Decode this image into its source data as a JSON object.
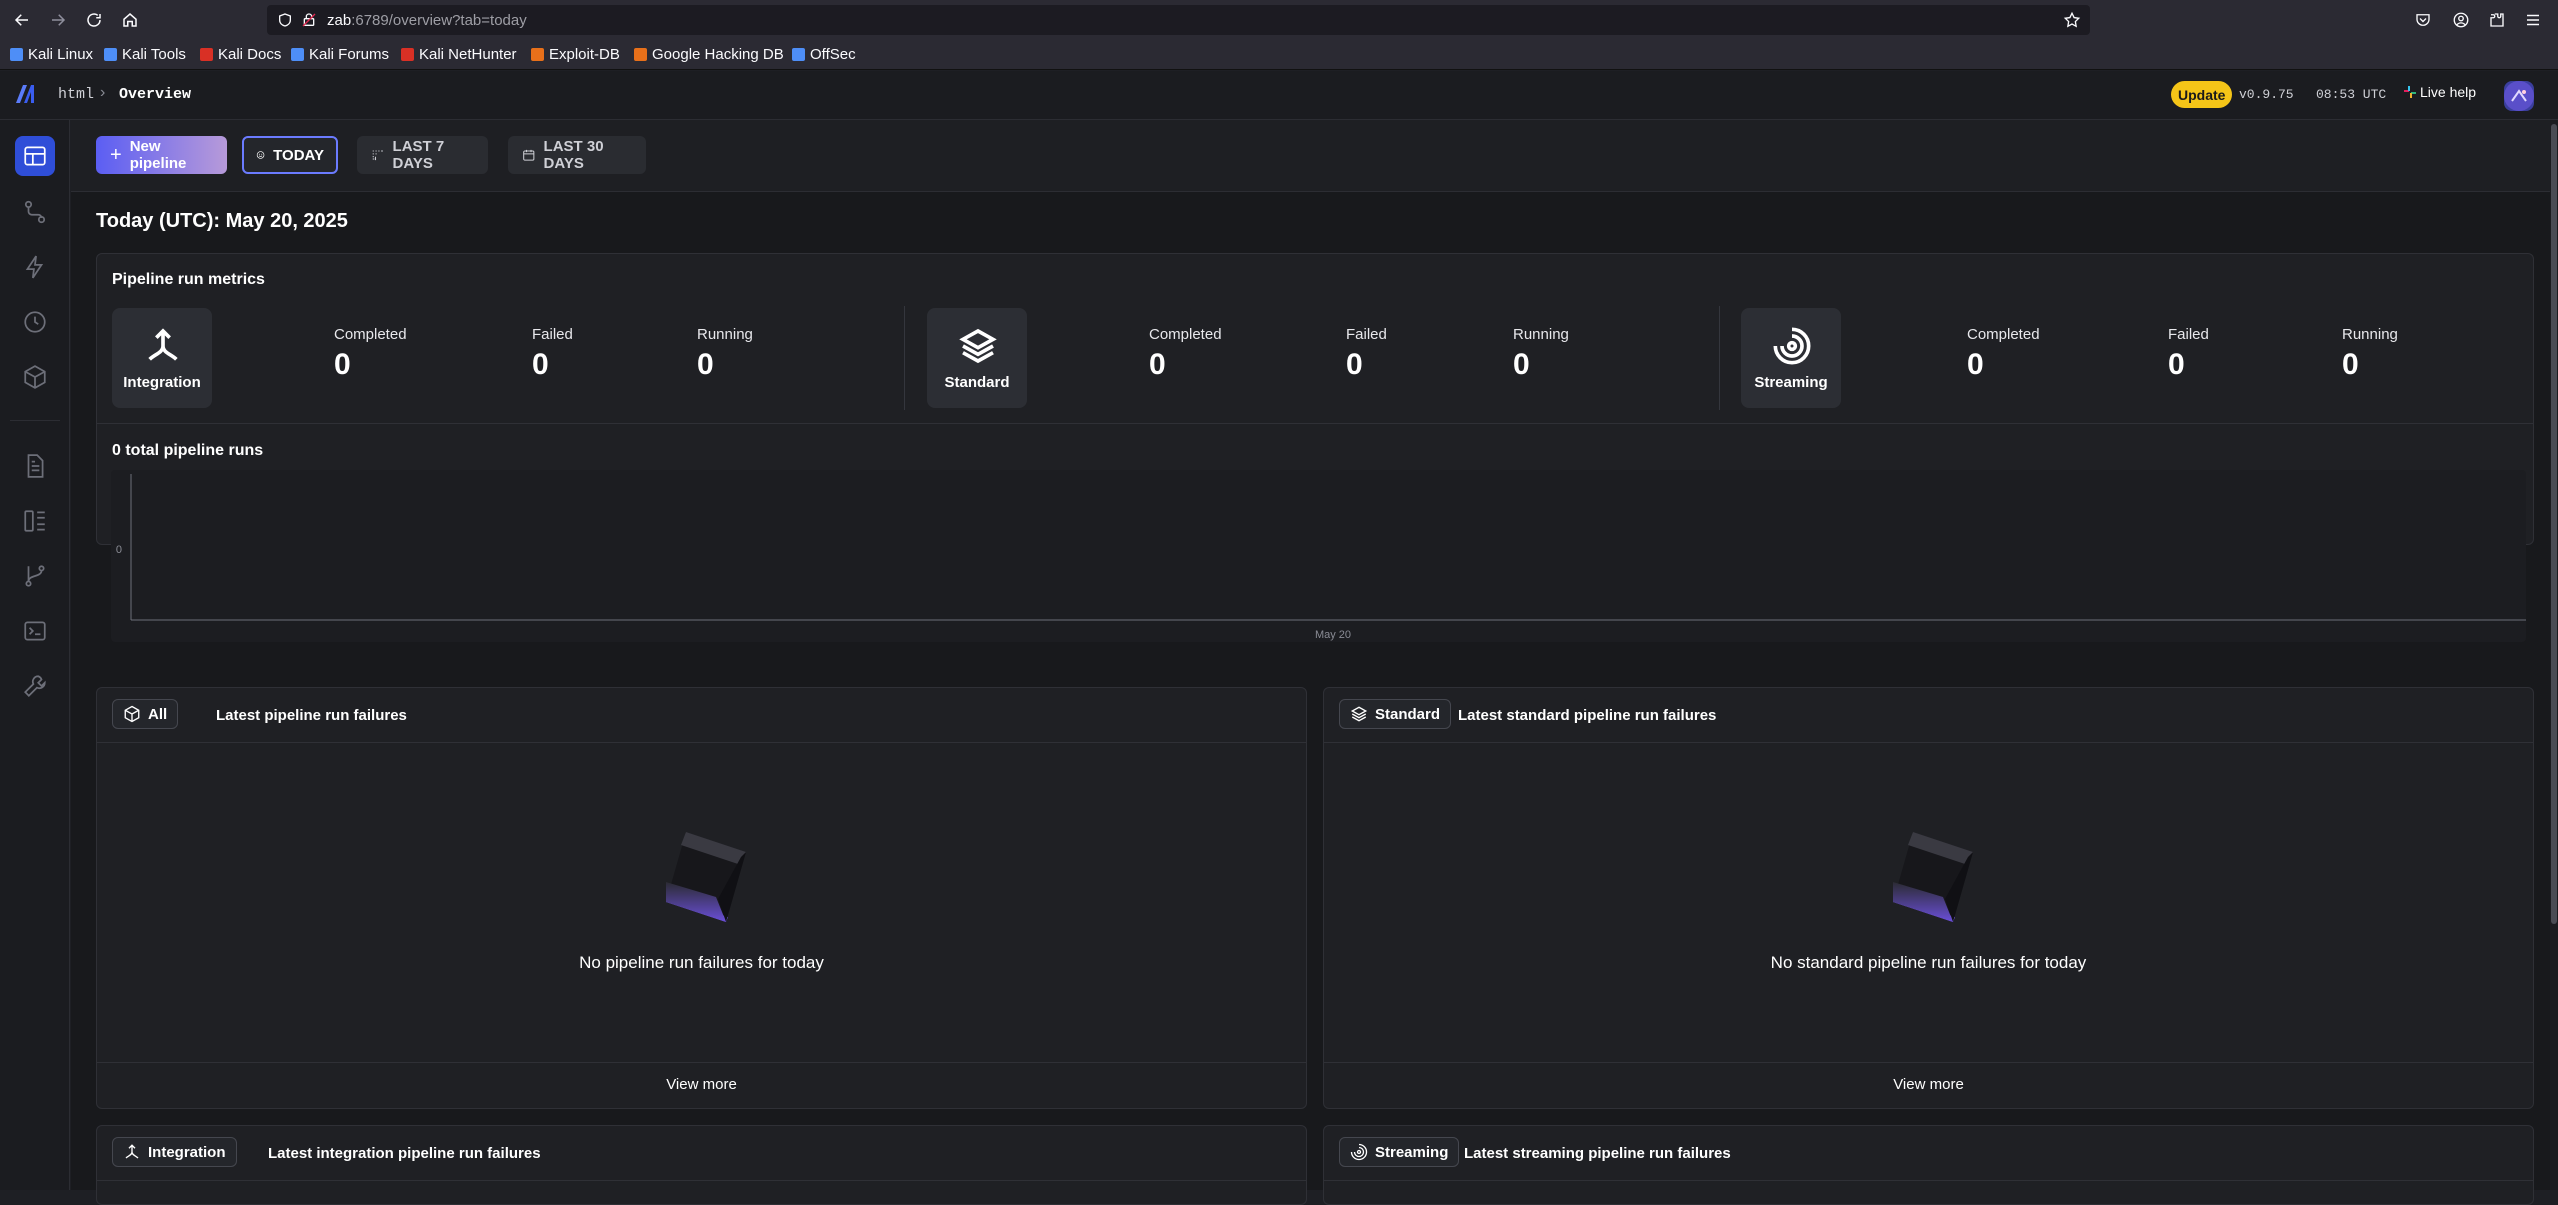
{
  "browser": {
    "url_host": "zab",
    "url_rest": ":6789/overview?tab=today",
    "bookmarks": [
      {
        "label": "Kali Linux",
        "color": "#4e8ef7"
      },
      {
        "label": "Kali Tools",
        "color": "#4e8ef7"
      },
      {
        "label": "Kali Docs",
        "color": "#d93025"
      },
      {
        "label": "Kali Forums",
        "color": "#4e8ef7"
      },
      {
        "label": "Kali NetHunter",
        "color": "#d93025"
      },
      {
        "label": "Exploit-DB",
        "color": "#e8701a"
      },
      {
        "label": "Google Hacking DB",
        "color": "#e8701a"
      },
      {
        "label": "OffSec",
        "color": "#4e8ef7"
      }
    ]
  },
  "header": {
    "breadcrumb_root": "html",
    "breadcrumb_current": "Overview",
    "update_label": "Update",
    "version": "v0.9.75",
    "time": "08:53 UTC",
    "live_help": "Live help"
  },
  "toolbar": {
    "new_pipeline": "New pipeline",
    "tabs": [
      "TODAY",
      "LAST 7 DAYS",
      "LAST 30 DAYS"
    ]
  },
  "page_title": "Today (UTC): May 20, 2025",
  "metrics": {
    "title": "Pipeline run metrics",
    "labels": {
      "completed": "Completed",
      "failed": "Failed",
      "running": "Running"
    },
    "groups": [
      {
        "type": "Integration",
        "completed": "0",
        "failed": "0",
        "running": "0"
      },
      {
        "type": "Standard",
        "completed": "0",
        "failed": "0",
        "running": "0"
      },
      {
        "type": "Streaming",
        "completed": "0",
        "failed": "0",
        "running": "0"
      }
    ]
  },
  "runs_chart": {
    "title": "0 total pipeline runs",
    "y_tick": "0",
    "x_tick": "May 20"
  },
  "chart_data": {
    "type": "bar",
    "title": "0 total pipeline runs",
    "categories": [
      "May 20"
    ],
    "values": [
      0
    ],
    "yticks": [
      "0"
    ],
    "xlabel": "",
    "ylabel": ""
  },
  "failures": [
    {
      "tag": "All",
      "title": "Latest pipeline run failures",
      "empty": "No pipeline run failures for today",
      "view_more": "View more"
    },
    {
      "tag": "Standard",
      "title": "Latest standard pipeline run failures",
      "empty": "No standard pipeline run failures for today",
      "view_more": "View more"
    },
    {
      "tag": "Integration",
      "title": "Latest integration pipeline run failures"
    },
    {
      "tag": "Streaming",
      "title": "Latest streaming pipeline run failures"
    }
  ],
  "colors": {
    "accent": "#2f4ed8",
    "update_badge": "#f5c518",
    "new_pipeline_gradient_start": "#5b5ef3",
    "new_pipeline_gradient_end": "#b79ad9"
  }
}
